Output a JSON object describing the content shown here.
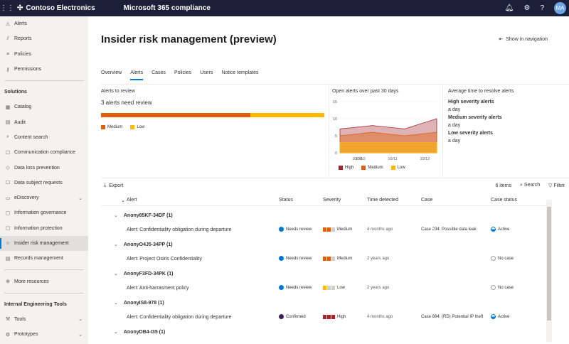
{
  "topbar": {
    "org": "Contoso Electronics",
    "app": "Microsoft 365 compliance",
    "avatar_initials": "MA"
  },
  "sidebar": {
    "items_top": [
      {
        "label": "Alerts",
        "icon": "warning-icon"
      },
      {
        "label": "Reports",
        "icon": "chart-icon"
      },
      {
        "label": "Policies",
        "icon": "list-icon"
      },
      {
        "label": "Permissions",
        "icon": "key-icon"
      }
    ],
    "section1": "Solutions",
    "solutions": [
      {
        "label": "Catalog",
        "icon": "catalog-icon"
      },
      {
        "label": "Audit",
        "icon": "audit-icon"
      },
      {
        "label": "Content search",
        "icon": "search-icon"
      },
      {
        "label": "Communication compliance",
        "icon": "chat-icon"
      },
      {
        "label": "Data loss prevention",
        "icon": "shield-icon"
      },
      {
        "label": "Data subject requests",
        "icon": "people-icon"
      },
      {
        "label": "eDiscovery",
        "icon": "folder-icon",
        "chevron": true
      },
      {
        "label": "Information governance",
        "icon": "lock-icon"
      },
      {
        "label": "Information protection",
        "icon": "shield-lock-icon"
      },
      {
        "label": "Insider risk management",
        "icon": "person-alert-icon",
        "active": true
      },
      {
        "label": "Records management",
        "icon": "records-icon"
      }
    ],
    "more": "More resources",
    "section2": "Internal Engineering Tools",
    "tools": [
      {
        "label": "Tools",
        "icon": "tools-icon"
      },
      {
        "label": "Prototypes",
        "icon": "prototype-icon"
      }
    ]
  },
  "page": {
    "title": "Insider risk management (preview)",
    "show_in_navigation": "Show in navigation",
    "tabs": [
      "Overview",
      "Alerts",
      "Cases",
      "Policies",
      "Users",
      "Notice templates"
    ],
    "active_tab": "Alerts"
  },
  "alerts_to_review": {
    "title": "Alerts to review",
    "count_text": "3 alerts need review",
    "medium_fraction": 0.67,
    "low_fraction": 0.33,
    "legend_medium": "Medium",
    "legend_low": "Low"
  },
  "colors": {
    "high": "#a4262c",
    "medium": "#e06010",
    "low": "#ffb900",
    "accent": "#0078d4"
  },
  "chart_data": {
    "type": "area",
    "title": "Open alerts over past 30 days",
    "x": [
      "10/09",
      "10/10",
      "10/11",
      "10/12"
    ],
    "ylim": [
      0,
      15
    ],
    "yticks": [
      0,
      5,
      10,
      15
    ],
    "grid": true,
    "legend_placement": "bottom",
    "series": [
      {
        "name": "High",
        "values": [
          7,
          8,
          7,
          10
        ],
        "color": "#a4262c"
      },
      {
        "name": "Medium",
        "values": [
          5,
          6,
          5,
          6
        ],
        "color": "#e06010"
      },
      {
        "name": "Low",
        "values": [
          3,
          3,
          3,
          3
        ],
        "color": "#ffb900"
      }
    ]
  },
  "resolve": {
    "title": "Average time to resolve alerts",
    "items": [
      {
        "label": "High severity alerts",
        "value": "a day"
      },
      {
        "label": "Medium severity alerts",
        "value": "a day"
      },
      {
        "label": "Low severity alerts",
        "value": "a day"
      }
    ]
  },
  "toolbar": {
    "export": "Export",
    "items_count": "6 items",
    "search": "Search",
    "filter": "Filter"
  },
  "table": {
    "headers": {
      "alert": "Alert",
      "status": "Status",
      "severity": "Severity",
      "time": "Time detected",
      "case": "Case",
      "case_status": "Case status"
    },
    "groups": [
      {
        "name": "Anony85KF-34DF (1)",
        "alert": "Alert: Confidentiality obligation during departure",
        "status": "Needs review",
        "status_color": "#0078d4",
        "severity": "Medium",
        "sev_level": 2,
        "time": "4 months ago",
        "case": "Case 234: Possible data leak",
        "case_status": "Active",
        "case_active": true
      },
      {
        "name": "AnonyO4J5-34PP (1)",
        "alert": "Alert: Project Osiris Confidentiality",
        "status": "Needs review",
        "status_color": "#0078d4",
        "severity": "Medium",
        "sev_level": 2,
        "time": "2 years ago",
        "case": "",
        "case_status": "No case",
        "case_active": false
      },
      {
        "name": "AnonyF3FD-34PK (1)",
        "alert": "Alert: Anti-harrasment policy",
        "status": "Needs review",
        "status_color": "#0078d4",
        "severity": "Low",
        "sev_level": 1,
        "time": "2 years ago",
        "case": "",
        "case_status": "No case",
        "case_active": false
      },
      {
        "name": "AnonyIS8-978 (1)",
        "alert": "Alert: Confidentiality obligation during departure",
        "status": "Confirmed",
        "status_color": "#3b1f57",
        "severity": "High",
        "sev_level": 3,
        "time": "4 months ago",
        "case": "Case 884: (RD) Potential IP theft",
        "case_status": "Active",
        "case_active": true
      },
      {
        "name": "AnonyDB4-I35 (1)",
        "alert": "",
        "status": "",
        "status_color": "",
        "severity": "",
        "sev_level": 0,
        "time": "",
        "case": "",
        "case_status": "",
        "case_active": false
      }
    ]
  }
}
